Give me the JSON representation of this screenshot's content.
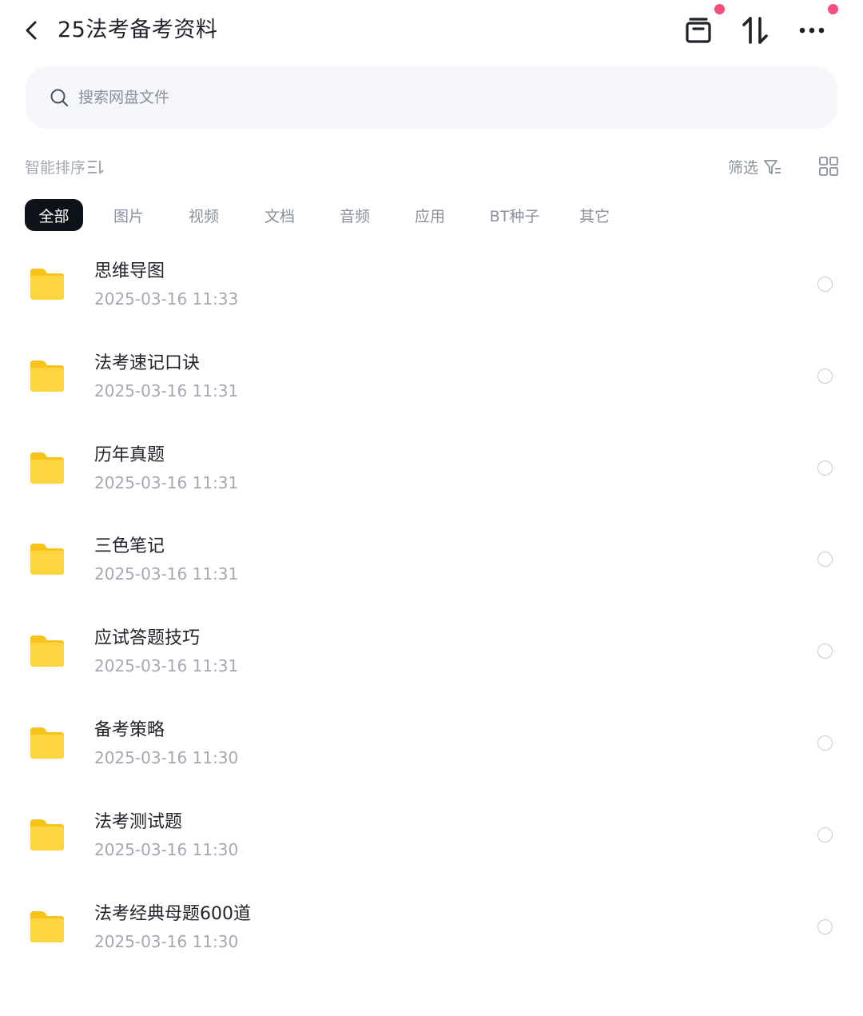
{
  "header": {
    "title": "25法考备考资料",
    "icons": [
      "back-icon",
      "archive-icon",
      "sort-icon",
      "more-icon"
    ],
    "badge_color": "#f0507a"
  },
  "search": {
    "placeholder": "搜索网盘文件"
  },
  "toolbar": {
    "sort_label": "智能排序",
    "filter_label": "筛选"
  },
  "tabs": [
    {
      "label": "全部",
      "active": true
    },
    {
      "label": "图片",
      "active": false
    },
    {
      "label": "视频",
      "active": false
    },
    {
      "label": "文档",
      "active": false
    },
    {
      "label": "音频",
      "active": false
    },
    {
      "label": "应用",
      "active": false
    },
    {
      "label": "BT种子",
      "active": false
    },
    {
      "label": "其它",
      "active": false
    }
  ],
  "files": [
    {
      "name": "思维导图",
      "date": "2025-03-16  11:33"
    },
    {
      "name": "法考速记口诀",
      "date": "2025-03-16  11:31"
    },
    {
      "name": "历年真题",
      "date": "2025-03-16  11:31"
    },
    {
      "name": "三色笔记",
      "date": "2025-03-16  11:31"
    },
    {
      "name": "应试答题技巧",
      "date": "2025-03-16  11:31"
    },
    {
      "name": "备考策略",
      "date": "2025-03-16  11:30"
    },
    {
      "name": "法考测试题",
      "date": "2025-03-16  11:30"
    },
    {
      "name": "法考经典母题600道",
      "date": "2025-03-16  11:30"
    }
  ],
  "colors": {
    "accent_dark": "#0d1219",
    "folder": "#f9c81e",
    "muted_text": "#a3a8b3"
  }
}
